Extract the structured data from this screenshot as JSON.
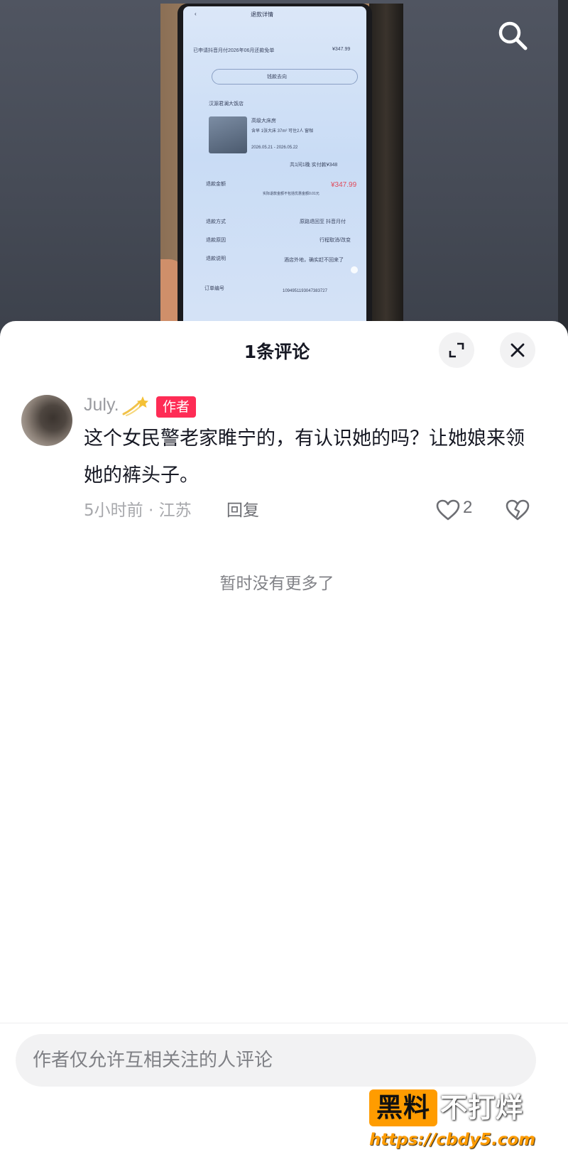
{
  "background_video": {
    "screen": {
      "nav_title": "退款详情",
      "summary": "已申请抖音月付2026年06月还款免单",
      "summary_amount": "¥347.99",
      "refund_dest_button": "钱款去向",
      "hotel_name": "汉源君澜大饭店",
      "room_name": "高级大床房",
      "room_desc": "含早 1张大床 37m² 可住2人 窗咖",
      "date_range": "2026.05.21 - 2026.05.22",
      "paid_line": "共1间1晚  实付款¥348",
      "refund_amount_label": "退款金额",
      "refund_amount": "¥347.99",
      "refund_amount_note": "实际退款金额不包括优惠金额0.01元",
      "refund_method_label": "退款方式",
      "refund_method": "原路退回至 抖音月付",
      "refund_reason_label": "退款原因",
      "refund_reason": "行程取消/改变",
      "refund_desc_label": "退款说明",
      "refund_desc": "酒店外地，确实赶不回来了",
      "order_no_label": "订单编号",
      "order_no": "1094951193047383727"
    }
  },
  "sheet": {
    "title": "1条评论",
    "icons": {
      "expand": "expand-icon",
      "close": "close-icon",
      "search": "search-icon"
    }
  },
  "comment": {
    "username": "July.",
    "username_emoji_icon": "shooting-star-icon",
    "badge": "作者",
    "text": "这个女民警老家睢宁的，有认识她的吗？让她娘来领她的裤头子。",
    "time_location": "5小时前 · 江苏",
    "reply": "回复",
    "likes": "2"
  },
  "no_more": "暂时没有更多了",
  "input": {
    "placeholder": "作者仅允许互相关注的人评论"
  },
  "watermark": {
    "badge": "黑料",
    "text": "不打烊",
    "url": "https://cbdy5.com"
  },
  "colors": {
    "accent_red": "#fe2c55",
    "watermark_orange": "#ff9c00",
    "sheet_bg": "#ffffff",
    "video_bg": "#454a55"
  }
}
